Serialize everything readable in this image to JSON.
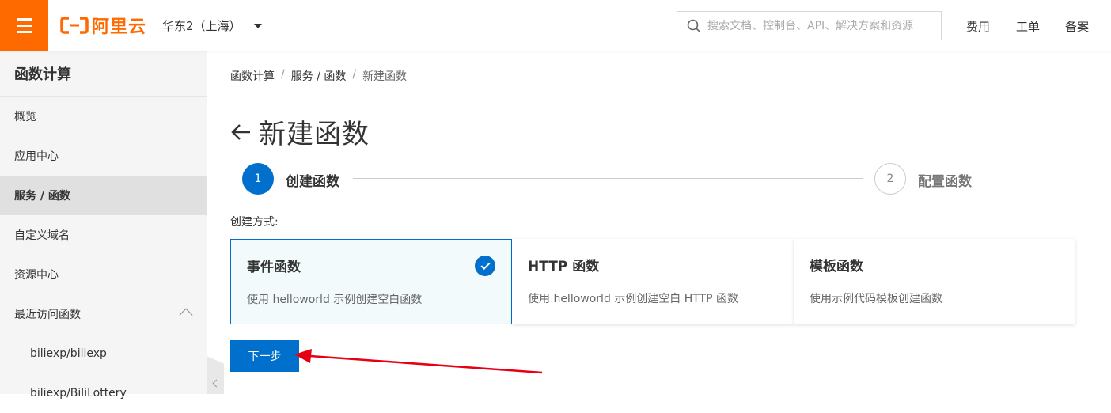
{
  "header": {
    "logo_text": "阿里云",
    "region": "华东2（上海）",
    "search_placeholder": "搜索文档、控制台、API、解决方案和资源",
    "links": [
      "费用",
      "工单",
      "备案"
    ]
  },
  "sidebar": {
    "title": "函数计算",
    "items": [
      {
        "label": "概览"
      },
      {
        "label": "应用中心"
      },
      {
        "label": "服务 / 函数"
      },
      {
        "label": "自定义域名"
      },
      {
        "label": "资源中心"
      },
      {
        "label": "最近访问函数"
      }
    ],
    "recent": [
      "biliexp/biliexp",
      "biliexp/BiliLottery"
    ]
  },
  "breadcrumb": [
    "函数计算",
    "服务 / 函数",
    "新建函数"
  ],
  "page": {
    "title": "新建函数",
    "back_icon": "arrow-left-icon"
  },
  "steps": [
    {
      "number": "1",
      "label": "创建函数"
    },
    {
      "number": "2",
      "label": "配置函数"
    }
  ],
  "creation_mode_label": "创建方式:",
  "cards": [
    {
      "title": "事件函数",
      "desc": "使用 helloworld 示例创建空白函数"
    },
    {
      "title": "HTTP 函数",
      "desc": "使用 helloworld 示例创建空白 HTTP 函数"
    },
    {
      "title": "模板函数",
      "desc": "使用示例代码模板创建函数"
    }
  ],
  "next_button": "下一步",
  "colors": {
    "brand_orange": "#ff6a00",
    "primary_blue": "#0070cc",
    "annotation_red": "#e60012"
  }
}
